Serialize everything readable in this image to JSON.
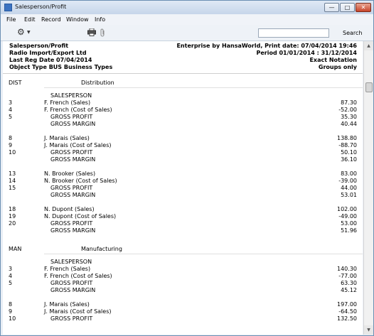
{
  "window": {
    "title": "Salesperson/Profit",
    "buttons": {
      "minimize": "—",
      "maximize": "□",
      "close": "✕"
    }
  },
  "menu": [
    "File",
    "Edit",
    "Record",
    "Window",
    "Info"
  ],
  "toolbar": {
    "icons": [
      "gear-icon",
      "printer-icon",
      "paperclip-icon"
    ],
    "search_value": "",
    "search_label": "Search"
  },
  "report_header": {
    "left": [
      "Salesperson/Profit",
      "Radio Import/Export Ltd",
      "Last Reg Date  07/04/2014",
      "Object Type  BUS  Business Types"
    ],
    "right": [
      "Enterprise by HansaWorld, Print date: 07/04/2014 19:46",
      "Period  01/01/2014 : 31/12/2014",
      "Exact Notation",
      "Groups only"
    ]
  },
  "report_rows": [
    {
      "type": "section",
      "code": "DIST",
      "label": "Distribution"
    },
    {
      "type": "heading",
      "label": "SALESPERSON"
    },
    {
      "type": "line",
      "code": "3",
      "label": "F. French (Sales)",
      "value": "87.30"
    },
    {
      "type": "line",
      "code": "4",
      "label": "F. French (Cost of Sales)",
      "value": "-52.00"
    },
    {
      "type": "sub",
      "code": "5",
      "label": "GROSS PROFIT",
      "value": "35.30"
    },
    {
      "type": "sub",
      "code": "",
      "label": "GROSS MARGIN",
      "value": "40.44"
    },
    {
      "type": "line",
      "code": "8",
      "label": "J. Marais (Sales)",
      "value": "138.80"
    },
    {
      "type": "line",
      "code": "9",
      "label": "J. Marais (Cost of Sales)",
      "value": "-88.70"
    },
    {
      "type": "sub",
      "code": "10",
      "label": "GROSS PROFIT",
      "value": "50.10"
    },
    {
      "type": "sub",
      "code": "",
      "label": "GROSS MARGIN",
      "value": "36.10"
    },
    {
      "type": "line",
      "code": "13",
      "label": "N. Brooker (Sales)",
      "value": "83.00"
    },
    {
      "type": "line",
      "code": "14",
      "label": "N. Brooker (Cost of Sales)",
      "value": "-39.00"
    },
    {
      "type": "sub",
      "code": "15",
      "label": "GROSS PROFIT",
      "value": "44.00"
    },
    {
      "type": "sub",
      "code": "",
      "label": "GROSS MARGIN",
      "value": "53.01"
    },
    {
      "type": "line",
      "code": "18",
      "label": "N. Dupont (Sales)",
      "value": "102.00"
    },
    {
      "type": "line",
      "code": "19",
      "label": "N. Dupont (Cost of Sales)",
      "value": "-49.00"
    },
    {
      "type": "sub",
      "code": "20",
      "label": "GROSS PROFIT",
      "value": "53.00"
    },
    {
      "type": "sub",
      "code": "",
      "label": "GROSS MARGIN",
      "value": "51.96"
    },
    {
      "type": "section",
      "code": "MAN",
      "label": "Manufacturing"
    },
    {
      "type": "heading",
      "label": "SALESPERSON"
    },
    {
      "type": "line",
      "code": "3",
      "label": "F. French (Sales)",
      "value": "140.30"
    },
    {
      "type": "line",
      "code": "4",
      "label": "F. French (Cost of Sales)",
      "value": "-77.00"
    },
    {
      "type": "sub",
      "code": "5",
      "label": "GROSS PROFIT",
      "value": "63.30"
    },
    {
      "type": "sub",
      "code": "",
      "label": "GROSS MARGIN",
      "value": "45.12"
    },
    {
      "type": "line",
      "code": "8",
      "label": "J. Marais (Sales)",
      "value": "197.00"
    },
    {
      "type": "line",
      "code": "9",
      "label": "J. Marais (Cost of Sales)",
      "value": "-64.50"
    },
    {
      "type": "sub",
      "code": "10",
      "label": "GROSS PROFIT",
      "value": "132.50"
    }
  ]
}
